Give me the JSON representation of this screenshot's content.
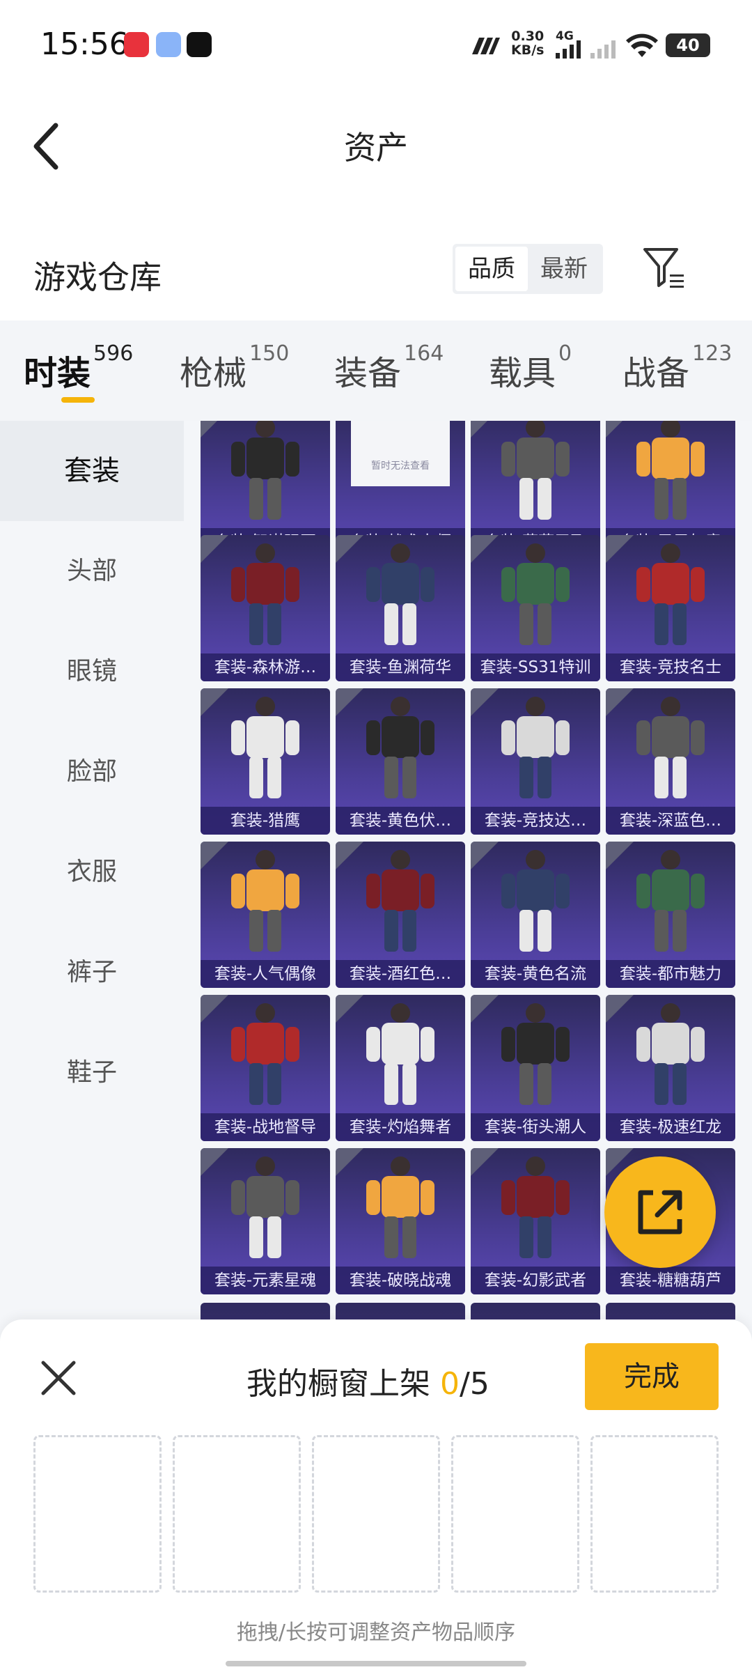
{
  "status": {
    "time": "15:56",
    "net_speed_top": "0.30",
    "net_speed_bottom": "KB/s",
    "net_type": "4G",
    "battery": "40"
  },
  "header": {
    "title": "资产"
  },
  "warehouse": {
    "title": "游戏仓库",
    "sort_options": [
      "品质",
      "最新"
    ],
    "active_sort": "品质"
  },
  "tabs": [
    {
      "label": "时装",
      "count": "596"
    },
    {
      "label": "枪械",
      "count": "150"
    },
    {
      "label": "装备",
      "count": "164"
    },
    {
      "label": "载具",
      "count": "0"
    },
    {
      "label": "战备",
      "count": "123"
    }
  ],
  "sidebar": [
    "套装",
    "头部",
    "眼镜",
    "脸部",
    "衣服",
    "裤子",
    "鞋子"
  ],
  "placeholder_text": "暂时无法查看",
  "items": [
    "套装-智谋强哥",
    "套装-战术大师",
    "套装-燕燕于飞",
    "套装-巳巳如意",
    "套装-森林游…",
    "套装-鱼渊荷华",
    "套装-SS31特训",
    "套装-竞技名士",
    "套装-猎鹰",
    "套装-黄色伏…",
    "套装-竞技达…",
    "套装-深蓝色…",
    "套装-人气偶像",
    "套装-酒红色…",
    "套装-黄色名流",
    "套装-都市魅力",
    "套装-战地督导",
    "套装-灼焰舞者",
    "套装-街头潮人",
    "套装-极速红龙",
    "套装-元素星魂",
    "套装-破晓战魂",
    "套装-幻影武者",
    "套装-糖糖葫芦"
  ],
  "sheet": {
    "title_prefix": "我的橱窗上架",
    "count": "0",
    "total": "/5",
    "done_label": "完成",
    "hint": "拖拽/长按可调整资产物品顺序"
  },
  "colors": {
    "accent": "#f8b71c",
    "card_bg": "#4a3d96"
  }
}
